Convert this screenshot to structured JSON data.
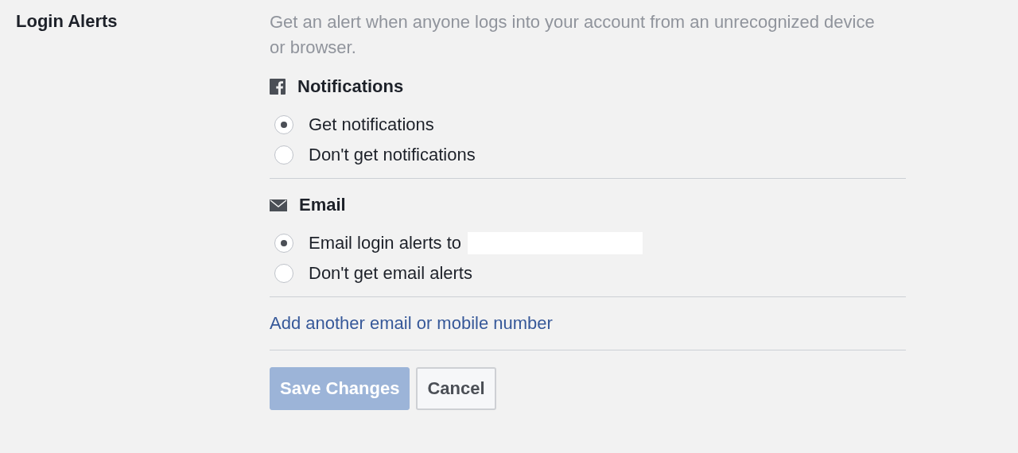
{
  "setting": {
    "title": "Login Alerts",
    "description": "Get an alert when anyone logs into your account from an unrecognized device or browser."
  },
  "sections": [
    {
      "kind": "notifications",
      "title": "Notifications",
      "options": [
        {
          "label": "Get notifications",
          "selected": true
        },
        {
          "label": "Don't get notifications",
          "selected": false
        }
      ]
    },
    {
      "kind": "email",
      "title": "Email",
      "options": [
        {
          "label": "Email login alerts to",
          "selected": true,
          "redacted": true
        },
        {
          "label": "Don't get email alerts",
          "selected": false
        }
      ]
    }
  ],
  "link": "Add another email or mobile number",
  "buttons": [
    {
      "kind": "primary",
      "label": "Save Changes",
      "disabled": true
    },
    {
      "kind": "secondary",
      "label": "Cancel",
      "disabled": false
    }
  ]
}
